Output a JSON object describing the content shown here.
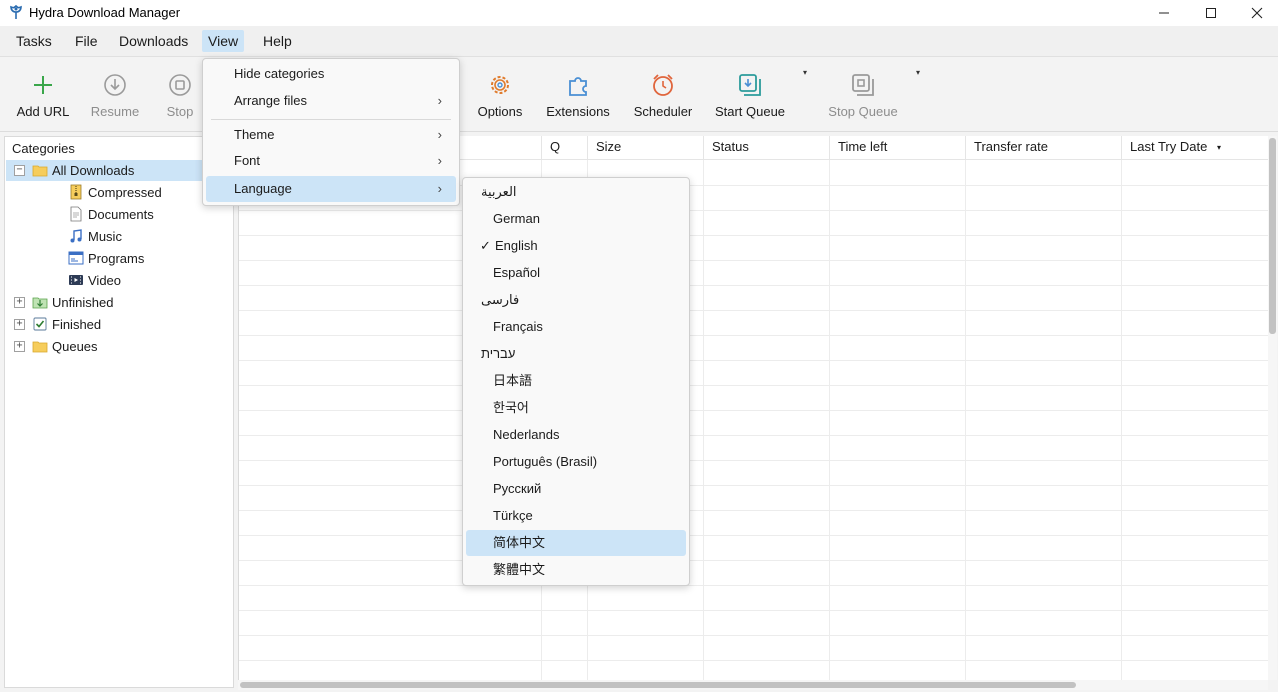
{
  "window": {
    "title": "Hydra Download Manager",
    "controls": [
      "minimize",
      "maximize",
      "close"
    ]
  },
  "menubar": {
    "items": [
      {
        "label": "Tasks"
      },
      {
        "label": "File"
      },
      {
        "label": "Downloads"
      },
      {
        "label": "View",
        "active": true
      },
      {
        "label": "Help"
      }
    ]
  },
  "toolbar": {
    "buttons": [
      {
        "label": "Add URL",
        "icon": "plus-icon",
        "enabled": true
      },
      {
        "label": "Resume",
        "icon": "download-circle-icon",
        "enabled": false
      },
      {
        "label": "Stop",
        "icon": "stop-circle-icon",
        "enabled": false
      },
      {
        "label": "Options",
        "icon": "gear-icon",
        "enabled": true
      },
      {
        "label": "Extensions",
        "icon": "puzzle-icon",
        "enabled": true
      },
      {
        "label": "Scheduler",
        "icon": "alarm-clock-icon",
        "enabled": true
      },
      {
        "label": "Start Queue",
        "icon": "queue-start-icon",
        "enabled": true
      },
      {
        "label": "Stop Queue",
        "icon": "queue-stop-icon",
        "enabled": false
      }
    ],
    "caret": "▾"
  },
  "sidebar": {
    "header": "Categories",
    "tree": [
      {
        "label": "All Downloads",
        "icon": "folder-icon",
        "expander": "−",
        "selected": true
      },
      {
        "label": "Compressed",
        "icon": "zip-file-icon"
      },
      {
        "label": "Documents",
        "icon": "document-icon"
      },
      {
        "label": "Music",
        "icon": "music-note-icon"
      },
      {
        "label": "Programs",
        "icon": "program-window-icon"
      },
      {
        "label": "Video",
        "icon": "video-film-icon"
      },
      {
        "label": "Unfinished",
        "icon": "unfinished-download-icon",
        "expander": "+"
      },
      {
        "label": "Finished",
        "icon": "finished-check-icon",
        "expander": "+"
      },
      {
        "label": "Queues",
        "icon": "queue-folder-icon",
        "expander": "+"
      }
    ]
  },
  "table": {
    "columns": [
      {
        "label": ""
      },
      {
        "label": "Q"
      },
      {
        "label": "Size"
      },
      {
        "label": "Status"
      },
      {
        "label": "Time left"
      },
      {
        "label": "Transfer rate"
      },
      {
        "label": "Last Try Date",
        "sort": "▾"
      }
    ],
    "rows": []
  },
  "view_menu": {
    "items": [
      {
        "label": "Hide categories",
        "submenu": false
      },
      {
        "label": "Arrange files",
        "submenu": true
      },
      {
        "label": "Theme",
        "submenu": true
      },
      {
        "label": "Font",
        "submenu": true
      },
      {
        "label": "Language",
        "submenu": true,
        "highlighted": true
      }
    ],
    "arrow": "›"
  },
  "language_menu": {
    "items": [
      {
        "label": "العربية",
        "rtl": true
      },
      {
        "label": "German"
      },
      {
        "label": "English",
        "checked": true
      },
      {
        "label": "Español"
      },
      {
        "label": "فارسی",
        "rtl": true
      },
      {
        "label": "Français"
      },
      {
        "label": "עברית",
        "rtl": true
      },
      {
        "label": "日本語"
      },
      {
        "label": "한국어"
      },
      {
        "label": "Nederlands"
      },
      {
        "label": "Português (Brasil)"
      },
      {
        "label": "Русский"
      },
      {
        "label": "Türkçe"
      },
      {
        "label": "简体中文",
        "highlighted": true
      },
      {
        "label": "繁體中文"
      }
    ],
    "check_mark": "✓"
  },
  "colors": {
    "selection": "#cce4f7",
    "accent_green": "#3aa64a",
    "accent_orange": "#e07b2c",
    "accent_blue": "#4a8fd4",
    "accent_teal": "#2c9c9c",
    "disabled": "#8d8d8d"
  }
}
